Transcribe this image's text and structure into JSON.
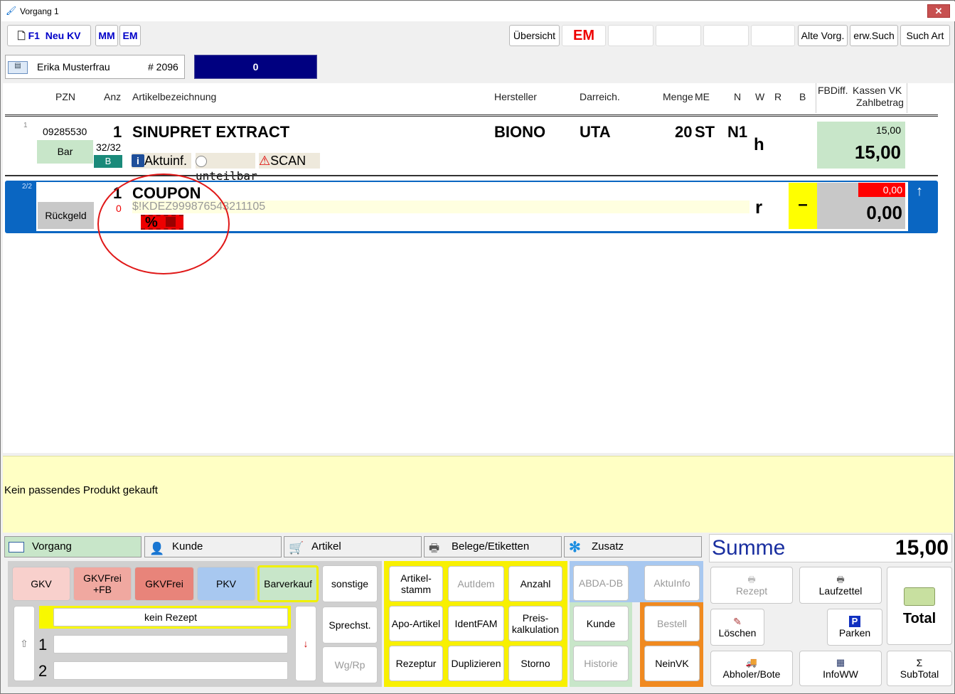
{
  "window": {
    "title": "Vorgang 1",
    "close": "✕"
  },
  "toolbar": {
    "f1": "F1",
    "neu_kv": "Neu KV",
    "mm": "MM",
    "em": "EM",
    "uebersicht": "Übersicht",
    "em_red": "EM",
    "alte_vorg": "Alte Vorg.",
    "erw_such": "erw.Such",
    "such_art": "Such Art"
  },
  "customer": {
    "name": "Erika Musterfrau",
    "number": "# 2096",
    "counter": "0"
  },
  "columns": {
    "pzn": "PZN",
    "anz": "Anz",
    "artikel": "Artikelbezeichnung",
    "hersteller": "Hersteller",
    "darreich": "Darreich.",
    "menge": "Menge",
    "me": "ME",
    "n": "N",
    "w": "W",
    "r": "R",
    "b": "B",
    "fbdiff": "FBDiff.",
    "kassen_vk": "Kassen VK",
    "zahlbetrag": "Zahlbetrag"
  },
  "rows": [
    {
      "index": "1",
      "pzn": "09285530",
      "anz": "1",
      "name": "SINUPRET EXTRACT",
      "hersteller": "BIONO",
      "darreich": "UTA",
      "menge": "20",
      "me": "ST",
      "n": "N1",
      "w": "h",
      "pay": "Bar",
      "stock": "32/32",
      "stock_badge": "B",
      "aktuinf": "Aktuinf.",
      "unteilbar": "unteilbar",
      "scan": "SCAN",
      "kassen_vk": "15,00",
      "zahlbetrag": "15,00"
    },
    {
      "index": "2/2",
      "anz": "1",
      "anz_red": "0",
      "name": "COUPON",
      "code": "$!KDEZ999876543211105",
      "pay": "Rückgeld",
      "w": "r",
      "minus": "–",
      "kassen_vk": "0,00",
      "zahlbetrag": "0,00",
      "badge": "%"
    }
  ],
  "message": "Kein passendes Produkt gekauft",
  "tabs": [
    "Vorgang",
    "Kunde",
    "Artikel",
    "Belege/Etiketten",
    "Zusatz"
  ],
  "summe": {
    "label": "Summe",
    "value": "15,00"
  },
  "rx_buttons": {
    "gkv": "GKV",
    "gkvfrei_fb": "GKVFrei +FB",
    "gkvfrei": "GKVFrei",
    "pkv": "PKV",
    "barverkauf": "Barverkauf"
  },
  "rezept": {
    "kein_rezept": "kein Rezept",
    "line1": "1",
    "line2": "2"
  },
  "misc_buttons": {
    "sonstige": "sonstige",
    "sprechst": "Sprechst.",
    "wgrp": "Wg/Rp"
  },
  "yellow_buttons": {
    "artikelstamm": "Artikel-stamm",
    "autidem": "AutIdem",
    "anzahl": "Anzahl",
    "apo_artikel": "Apo-Artikel",
    "identfam": "IdentFAM",
    "preiskalkulation": "Preis-kalkulation",
    "rezeptur": "Rezeptur",
    "duplizieren": "Duplizieren",
    "storno": "Storno"
  },
  "blue_buttons": {
    "abda_db": "ABDA-DB",
    "aktuinfo": "AktuInfo",
    "kunde": "Kunde",
    "historie": "Historie"
  },
  "orange_buttons": {
    "bestell": "Bestell",
    "neinvk": "NeinVK"
  },
  "right_buttons": {
    "rezept": "Rezept",
    "laufzettel": "Laufzettel",
    "total": "Total",
    "loeschen": "Löschen",
    "parken": "Parken",
    "abholer": "Abholer/Bote",
    "infoww": "InfoWW",
    "subtotal": "SubTotal"
  },
  "colors": {
    "navy": "#000080",
    "blue_row": "#0a66c2",
    "green_cell": "#c8e6c9",
    "red": "#e00000"
  }
}
